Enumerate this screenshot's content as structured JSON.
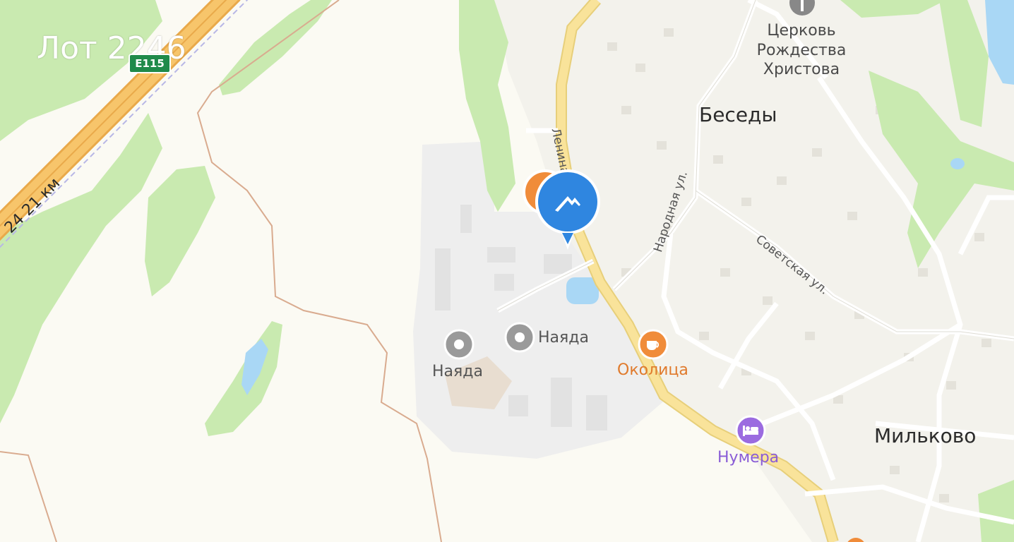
{
  "map": {
    "title": "Лот 2246",
    "road_shield": "Е115",
    "road_km": "24 21 км",
    "settlements": {
      "besedy": "Беседы",
      "milkovo": "Мильково"
    },
    "church": {
      "line1": "Церковь",
      "line2": "Рождества",
      "line3": "Христова"
    },
    "streets": {
      "lenina": "Ленина ул.",
      "narodnaya": "Народная ул.",
      "sovetskaya": "Советская ул."
    },
    "pois": {
      "nayada_1": "Наяда",
      "nayada_2": "Наяда",
      "okolitsa": "Околица",
      "numera": "Нумера"
    },
    "icons": {
      "pin": "house-marker-icon",
      "cafe": "cafe-icon",
      "hotel": "hotel-bed-icon",
      "place": "place-dot-icon",
      "church": "church-icon"
    },
    "colors": {
      "background": "#fbfaf3",
      "forest": "#c9eab0",
      "water": "#a9d7f5",
      "highway": "#f7c56b",
      "local_road": "#f9e39a",
      "pin_blue": "#2f86e0",
      "poi_orange": "#f08c3a",
      "poi_purple": "#9b6be0",
      "industrial": "#eeeeee"
    }
  }
}
